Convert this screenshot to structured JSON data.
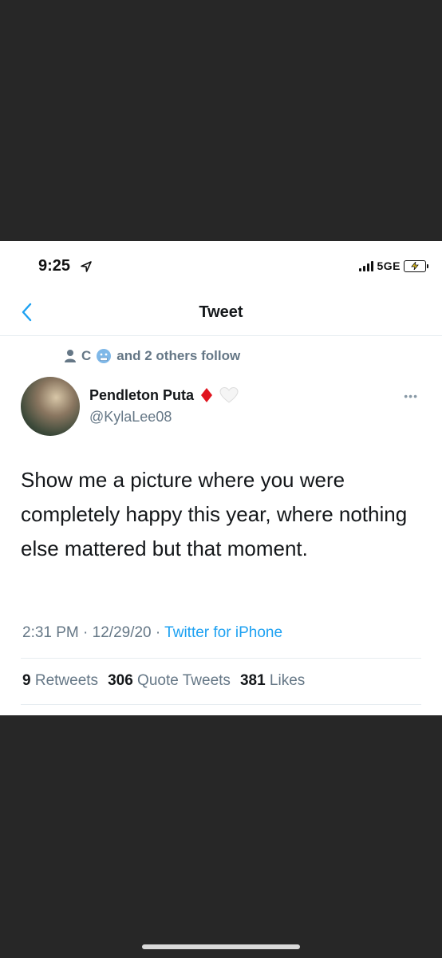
{
  "status_bar": {
    "time": "9:25",
    "network": "5GE"
  },
  "nav": {
    "title": "Tweet"
  },
  "social_context": {
    "initial": "C",
    "text": "and 2 others follow"
  },
  "author": {
    "name": "Pendleton Puta",
    "handle": "@KylaLee08"
  },
  "tweet": {
    "text": "Show me a picture where you were completely happy this year, where nothing else mattered but that moment.",
    "time": "2:31 PM",
    "date": "12/29/20",
    "source": "Twitter for iPhone"
  },
  "stats": {
    "retweets": "9",
    "retweets_label": "Retweets",
    "quotes": "306",
    "quotes_label": "Quote Tweets",
    "likes": "381",
    "likes_label": "Likes"
  },
  "colors": {
    "accent": "#1da1f2",
    "background": "#272727"
  },
  "icons": [
    "location-arrow-icon",
    "signal-icon",
    "battery-charging-icon",
    "back-chevron-icon",
    "person-icon",
    "cold-face-emoji-icon",
    "red-diamond-icon",
    "white-heart-icon",
    "more-icon"
  ]
}
